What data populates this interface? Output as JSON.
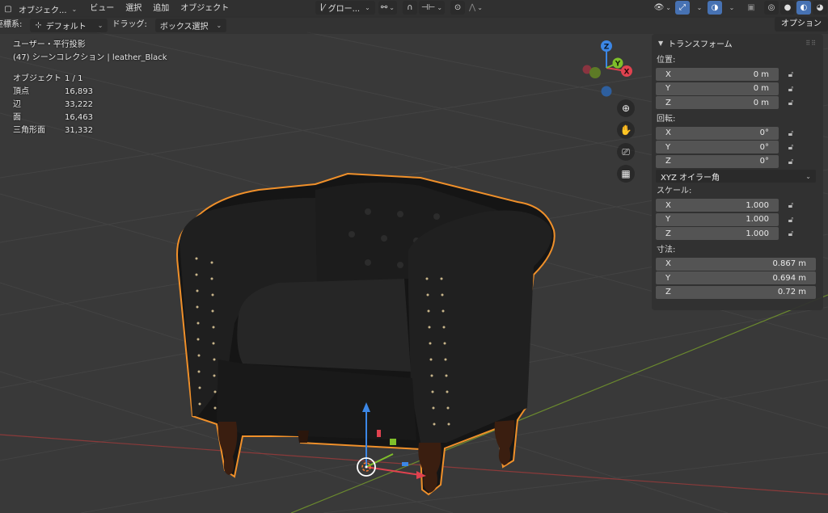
{
  "header": {
    "mode_label": "オブジェク...",
    "menus": [
      "ビュー",
      "選択",
      "追加",
      "オブジェクト"
    ],
    "transform_orientation": "グロー...",
    "snap_icon": "magnet-icon",
    "proportional_icon": "circle-dot-icon"
  },
  "toolsettings": {
    "coord_label": "座標系:",
    "coord_value": "デフォルト",
    "drag_label": "ドラッグ:",
    "drag_value": "ボックス選択",
    "options_label": "オプション"
  },
  "overlay": {
    "view_name": "ユーザー・平行投影",
    "collection": "(47) シーンコレクション | leather_Black",
    "stats": [
      {
        "label": "オブジェクト",
        "value": "1 / 1"
      },
      {
        "label": "頂点",
        "value": "16,893"
      },
      {
        "label": "辺",
        "value": "33,222"
      },
      {
        "label": "面",
        "value": "16,463"
      },
      {
        "label": "三角形面",
        "value": "31,332"
      }
    ]
  },
  "gizmo": {
    "x": "X",
    "y": "Y",
    "z": "Z"
  },
  "nav_buttons": [
    "zoom-icon",
    "hand-pan-icon",
    "camera-icon",
    "grid-ortho-icon"
  ],
  "npanel": {
    "title": "トランスフォーム",
    "location_label": "位置:",
    "location": [
      {
        "axis": "X",
        "value": "0 m"
      },
      {
        "axis": "Y",
        "value": "0 m"
      },
      {
        "axis": "Z",
        "value": "0 m"
      }
    ],
    "rotation_label": "回転:",
    "rotation": [
      {
        "axis": "X",
        "value": "0°"
      },
      {
        "axis": "Y",
        "value": "0°"
      },
      {
        "axis": "Z",
        "value": "0°"
      }
    ],
    "rotation_mode": "XYZ オイラー角",
    "scale_label": "スケール:",
    "scale": [
      {
        "axis": "X",
        "value": "1.000"
      },
      {
        "axis": "Y",
        "value": "1.000"
      },
      {
        "axis": "Z",
        "value": "1.000"
      }
    ],
    "dimensions_label": "寸法:",
    "dimensions": [
      {
        "axis": "X",
        "value": "0.867 m"
      },
      {
        "axis": "Y",
        "value": "0.694 m"
      },
      {
        "axis": "Z",
        "value": "0.72 m"
      }
    ]
  },
  "colors": {
    "outline": "#f0902a",
    "active_blue": "#4772b3",
    "axis_x": "#e0424f",
    "axis_y": "#7fbf2a",
    "axis_z": "#3c87e6"
  }
}
